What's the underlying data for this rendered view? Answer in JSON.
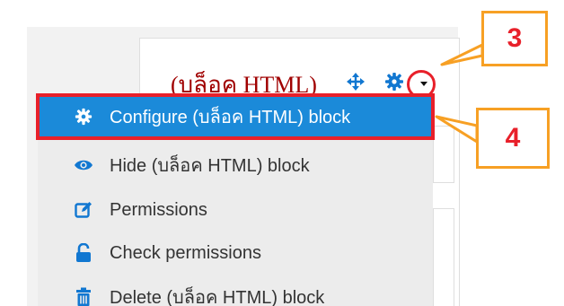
{
  "block": {
    "title": "(บล็อค HTML)"
  },
  "menu": {
    "items": [
      {
        "label": "Configure (บล็อค HTML) block",
        "icon": "gear-icon",
        "active": true
      },
      {
        "label": "Hide (บล็อค HTML) block",
        "icon": "eye-icon"
      },
      {
        "label": "Permissions",
        "icon": "edit-icon"
      },
      {
        "label": "Check permissions",
        "icon": "unlock-icon"
      },
      {
        "label": "Delete (บล็อค HTML) block",
        "icon": "trash-icon"
      }
    ]
  },
  "annotations": {
    "callout_3": "3",
    "callout_4": "4"
  },
  "colors": {
    "accent": "#1b8ad9",
    "highlight_border": "#e8202a",
    "callout_border": "#f7a024",
    "title_color": "#a00000"
  }
}
